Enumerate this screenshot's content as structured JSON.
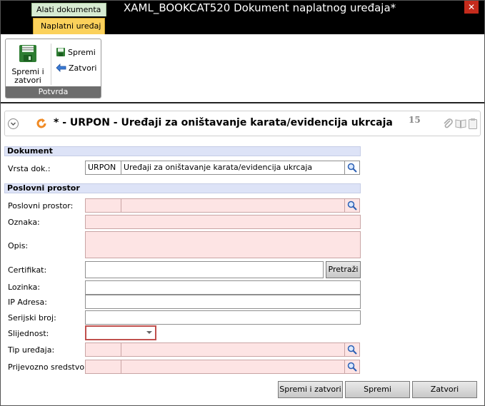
{
  "window": {
    "context_tab": "Alati dokumenta",
    "title": "XAML_BOOKCAT520  Dokument naplatnog uređaja*",
    "close_label": "✕"
  },
  "ribbon": {
    "tab": "Naplatni uređaj",
    "group_label": "Potvrda",
    "save_close_label_1": "Spremi i",
    "save_close_label_2": "zatvori",
    "save_label": "Spremi",
    "close_label": "Zatvori"
  },
  "header": {
    "title": "* - URPON - Uređaji za oništavanje karata/evidencija ukrcaja",
    "count": "15"
  },
  "form": {
    "section_dokument": "Dokument",
    "vrsta_label": "Vrsta dok.:",
    "vrsta_code": "URPON",
    "vrsta_name": "Uređaji za oništavanje karata/evidencija ukrcaja",
    "section_poslovni": "Poslovni prostor",
    "poslovni_label": "Poslovni prostor:",
    "poslovni_code": "",
    "poslovni_name": "",
    "oznaka_label": "Oznaka:",
    "oznaka_value": "",
    "opis_label": "Opis:",
    "opis_value": "",
    "certifikat_label": "Certifikat:",
    "certifikat_value": "",
    "pretrazi_label": "Pretraži",
    "lozinka_label": "Lozinka:",
    "lozinka_value": "",
    "ip_label": "IP Adresa:",
    "ip_value": "",
    "serijski_label": "Serijski broj:",
    "serijski_value": "",
    "slijednost_label": "Slijednost:",
    "slijednost_value": "",
    "tip_label": "Tip uređaja:",
    "tip_code": "",
    "tip_name": "",
    "prijevozno_label": "Prijevozno sredstvo:",
    "prijevozno_code": "",
    "prijevozno_name": ""
  },
  "footer": {
    "save_close": "Spremi i zatvori",
    "save": "Spremi",
    "close": "Zatvori"
  },
  "colors": {
    "required_bg": "#fde4e4",
    "section_bg": "#dde3f7",
    "ribbon_tab": "#fbd15b",
    "context_tab": "#d7ebd2",
    "close_red": "#c42b1c"
  }
}
